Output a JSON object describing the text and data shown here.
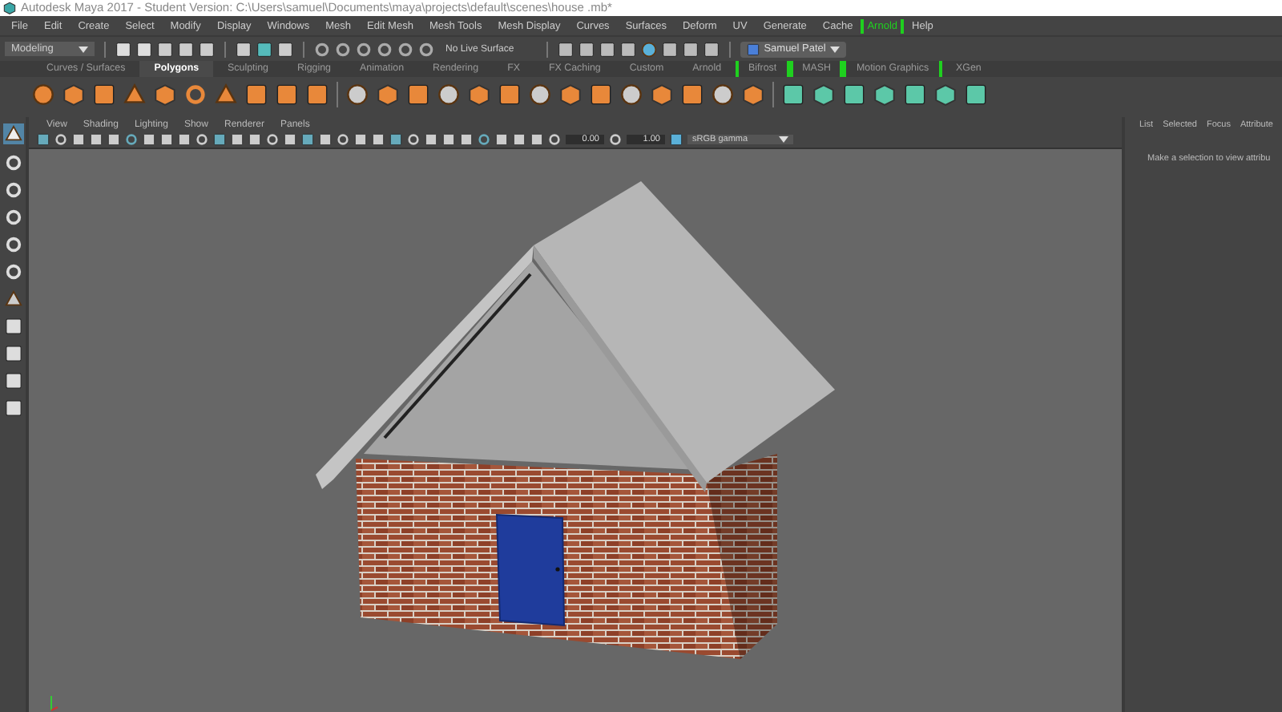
{
  "window": {
    "title": "Autodesk Maya 2017 - Student Version: C:\\Users\\samuel\\Documents\\maya\\projects\\default\\scenes\\house .mb*"
  },
  "menu_bar": [
    {
      "label": "File",
      "highlighted": false
    },
    {
      "label": "Edit",
      "highlighted": false
    },
    {
      "label": "Create",
      "highlighted": false
    },
    {
      "label": "Select",
      "highlighted": false
    },
    {
      "label": "Modify",
      "highlighted": false
    },
    {
      "label": "Display",
      "highlighted": false
    },
    {
      "label": "Windows",
      "highlighted": false
    },
    {
      "label": "Mesh",
      "highlighted": false
    },
    {
      "label": "Edit Mesh",
      "highlighted": false
    },
    {
      "label": "Mesh Tools",
      "highlighted": false
    },
    {
      "label": "Mesh Display",
      "highlighted": false
    },
    {
      "label": "Curves",
      "highlighted": false
    },
    {
      "label": "Surfaces",
      "highlighted": false
    },
    {
      "label": "Deform",
      "highlighted": false
    },
    {
      "label": "UV",
      "highlighted": false
    },
    {
      "label": "Generate",
      "highlighted": false
    },
    {
      "label": "Cache",
      "highlighted": false
    },
    {
      "label": "Arnold",
      "highlighted": true
    },
    {
      "label": "Help",
      "highlighted": false
    }
  ],
  "status_line": {
    "mode": "Modeling",
    "live_surface": "No Live Surface",
    "user": "Samuel Patel"
  },
  "shelf_tabs": [
    {
      "label": "Curves / Surfaces",
      "selected": false,
      "highlighted": false
    },
    {
      "label": "Polygons",
      "selected": true,
      "highlighted": false
    },
    {
      "label": "Sculpting",
      "selected": false,
      "highlighted": false
    },
    {
      "label": "Rigging",
      "selected": false,
      "highlighted": false
    },
    {
      "label": "Animation",
      "selected": false,
      "highlighted": false
    },
    {
      "label": "Rendering",
      "selected": false,
      "highlighted": false
    },
    {
      "label": "FX",
      "selected": false,
      "highlighted": false
    },
    {
      "label": "FX Caching",
      "selected": false,
      "highlighted": false
    },
    {
      "label": "Custom",
      "selected": false,
      "highlighted": false
    },
    {
      "label": "Arnold",
      "selected": false,
      "highlighted": false
    },
    {
      "label": "Bifrost",
      "selected": false,
      "highlighted": true
    },
    {
      "label": "MASH",
      "selected": false,
      "highlighted": true
    },
    {
      "label": "Motion Graphics",
      "selected": false,
      "highlighted": true
    },
    {
      "label": "XGen",
      "selected": false,
      "highlighted": false
    }
  ],
  "viewport": {
    "menu": [
      "View",
      "Shading",
      "Lighting",
      "Show",
      "Renderer",
      "Panels"
    ],
    "exposure": "0.00",
    "gamma": "1.00",
    "color_space": "sRGB gamma"
  },
  "attribute_panel": {
    "tabs": [
      "List",
      "Selected",
      "Focus",
      "Attribute"
    ],
    "message": "Make a selection to view attribu"
  }
}
